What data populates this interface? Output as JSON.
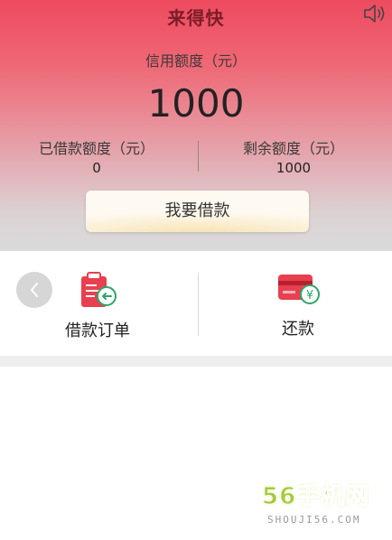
{
  "header": {
    "title": "来得快",
    "sound_icon": "speaker-icon"
  },
  "credit": {
    "label": "信用额度（元）",
    "amount": "1000"
  },
  "stats": {
    "borrowed_label": "已借款额度（元）",
    "borrowed_value": "0",
    "remaining_label": "剩余额度（元）",
    "remaining_value": "1000"
  },
  "actions": {
    "borrow_label": "我要借款",
    "back_icon": "chevron-left-icon"
  },
  "entries": [
    {
      "label": "借款订单",
      "icon": "clipboard-order-icon"
    },
    {
      "label": "还款",
      "icon": "card-repay-icon"
    }
  ],
  "watermark": {
    "main": "56手机网",
    "sub": "SHOUJI56.COM"
  },
  "colors": {
    "header_top": "#ee4a60",
    "header_bottom": "#dadada",
    "accent_red": "#e8404f",
    "repay_green": "#2fa56a",
    "watermark_green": "#a6c93b"
  }
}
